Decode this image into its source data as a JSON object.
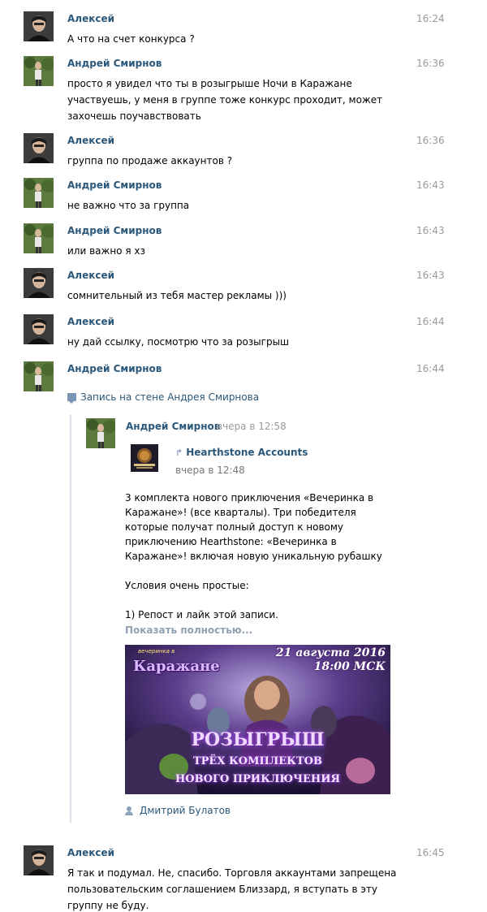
{
  "messages": [
    {
      "author": "Алексей",
      "time": "16:24",
      "text": "А что на счет конкурса ?"
    },
    {
      "author": "Андрей Смирнов",
      "time": "16:36",
      "text": "просто я увидел что ты в розыгрыше Ночи в Каражане участвуешь, у меня в группе тоже конкурс проходит, может захочешь поучавствовать"
    },
    {
      "author": "Алексей",
      "time": "16:36",
      "text": "группа по продаже аккаунтов ?"
    },
    {
      "author": "Андрей Смирнов",
      "time": "16:43",
      "text": "не важно что за группа"
    },
    {
      "author": "Андрей Смирнов",
      "time": "16:43",
      "text": "или важно я хз"
    },
    {
      "author": "Алексей",
      "time": "16:43",
      "text": "сомнительный из тебя мастер рекламы )))"
    },
    {
      "author": "Алексей",
      "time": "16:44",
      "text": "ну дай ссылку, посмотрю что за розыгрыш"
    },
    {
      "author": "Андрей Смирнов",
      "time": "16:44",
      "text": ""
    },
    {
      "author": "Алексей",
      "time": "16:45",
      "text": "Я так и подумал. Не, спасибо. Торговля аккаунтами запрещена пользовательским соглашением Близзард, я вступать в эту группу не буду."
    }
  ],
  "wall_post": {
    "link_label": "Запись на стене Андрея Смирнова",
    "author": "Андрей Смирнов",
    "date": "вчера в 12:58",
    "source": {
      "name": "Hearthstone Accounts",
      "date": "вчера в 12:48"
    },
    "text_p1": "3 комплекта нового приключения «Вечеринка в Каражане»! (все кварталы). Три победителя которые получат полный доступ к новому приключению Hearthstone: «Вечеринка в Каражане»! включая новую уникальную рубашку",
    "text_p2": "Условия очень простые:",
    "text_p3": "1) Репост и лайк этой записи.",
    "show_more": "Показать полностью...",
    "banner": {
      "date_line1": "21 августа 2016",
      "date_line2": "18:00 МСК",
      "logo_sub": "вечеринка в",
      "logo": "Каражане",
      "title": "РОЗЫГРЫШ",
      "line2": "ТРЁХ КОМПЛЕКТОВ",
      "line3": "НОВОГО ПРИКЛЮЧЕНИЯ"
    },
    "signer": "Дмитрий Булатов"
  },
  "colors": {
    "link": "#2b587a",
    "time": "#999999",
    "show_more": "#8fa1b3",
    "repost_bar": "#dbe2ea"
  },
  "icons": {
    "wall": "comment-icon",
    "repost": "repost-arrow-icon",
    "signer": "person-icon"
  }
}
